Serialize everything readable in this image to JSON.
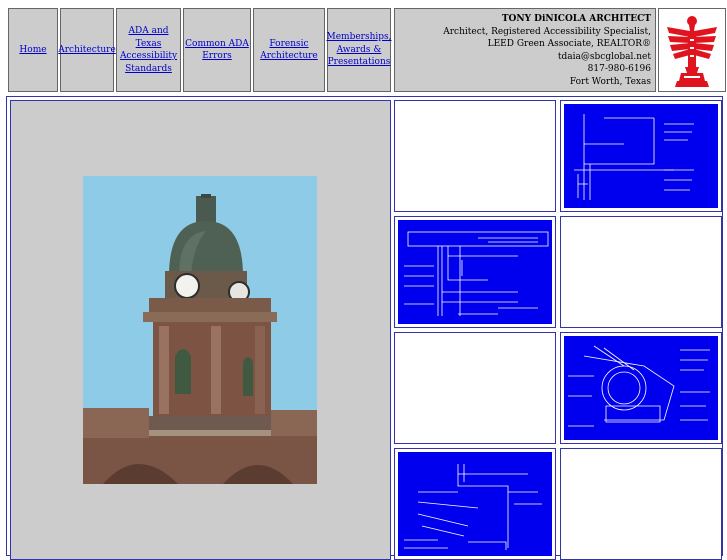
{
  "nav": {
    "home": "Home",
    "architecture": "Architecture",
    "ada_line1": "ADA and",
    "ada_line2": "Texas",
    "ada_line3": "Accessibility",
    "ada_line4": "Standards",
    "errors_line1": "Common ADA",
    "errors_line2": "Errors",
    "forensic_line1": "Forensic",
    "forensic_line2": "Architecture",
    "memberships_line1": "Memberships,",
    "memberships_line2": "Awards &",
    "memberships_line3": "Presentations"
  },
  "contact": {
    "name": "TONY DiNICOLA ARCHITECT",
    "line1": "Architect, Registered Accessibility Specialist,",
    "line2": "LEED Green Associate, REALTOR®",
    "email": "tdaia@sbcglobal.net",
    "phone": "817-980-6196",
    "location": "Fort Worth, Texas"
  },
  "colors": {
    "nav_bg": "#cccccc",
    "link": "#0000cc",
    "drawing_bg": "#0000ee",
    "logo_red": "#e0141e",
    "border": "#3333aa"
  },
  "icons": {
    "logo": "aia-eagle-logo"
  }
}
